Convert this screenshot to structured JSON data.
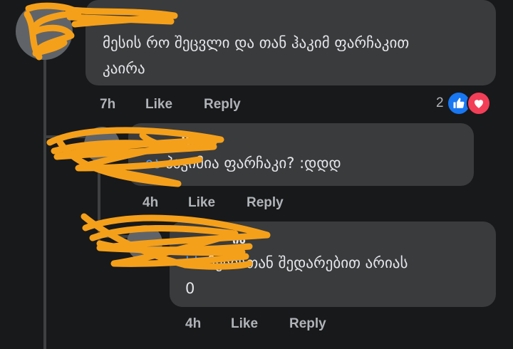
{
  "comments": [
    {
      "author": "",
      "text": "მესის რო შეცვლი და თან ჰაკიმ ფარჩაკით კაირა",
      "mention": "",
      "time": "7h",
      "like_label": "Like",
      "reply_label": "Reply",
      "reaction_count": "2",
      "reactions": [
        "like-icon",
        "love-icon"
      ]
    },
    {
      "author": "Kkk",
      "mention": "ია",
      "text": " ჰაკიმია ფარჩაკი? :დდდ",
      "time": "4h",
      "like_label": "Like",
      "reply_label": "Reply"
    },
    {
      "author": "ია",
      "mention": "kk",
      "text": " მესისთან შედარებით არიას 0",
      "time": "4h",
      "like_label": "Like",
      "reply_label": "Reply"
    }
  ],
  "colors": {
    "background": "#18191a",
    "bubble": "#3a3b3c",
    "text": "#e4e6eb",
    "secondary": "#b0b3b8",
    "mention": "#4599ff",
    "like": "#1877f2",
    "love": "#f33e58",
    "scribble": "#f5a01a"
  }
}
